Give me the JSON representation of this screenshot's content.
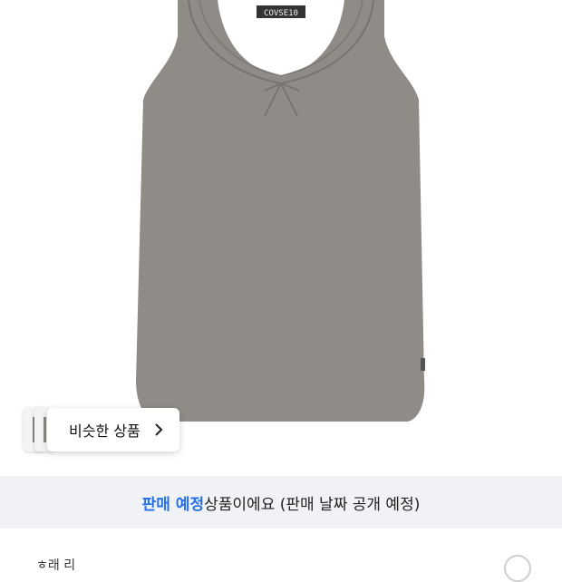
{
  "product": {
    "image_alt": "Gray sleeveless tank top with bow detail",
    "brand_tag": "COVSE10",
    "garment_color": "#8f8b87"
  },
  "similar": {
    "label": "비슷한 상품",
    "arrow_icon": "chevron-right-icon"
  },
  "notice": {
    "highlight": "판매 예정",
    "rest": "상품이에요 (판매 날짜 공개 예정)",
    "highlight_color": "#2470e8"
  },
  "below": {
    "partial_text": "ㅎ래 리"
  }
}
